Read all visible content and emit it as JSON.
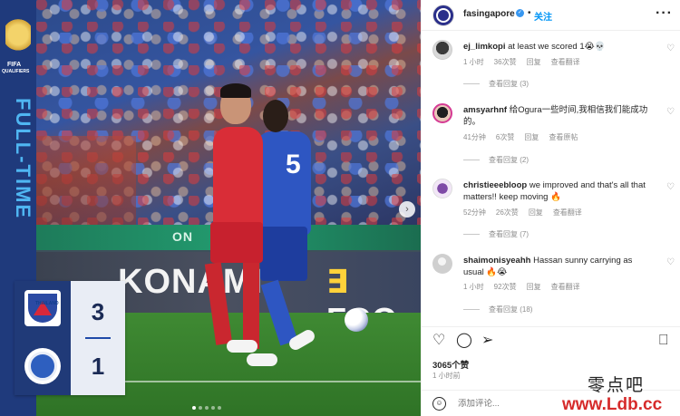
{
  "post": {
    "username": "fasingapore",
    "follow_label": "关注",
    "likes": "3065个赞",
    "time_ago": "1 小时前",
    "comment_placeholder": "添加评论..."
  },
  "media": {
    "sidebar_fifa": "FIFA",
    "sidebar_qualifiers": "QUALIFIERS",
    "sidebar_status": "FULL-TIME",
    "ad_board_text": "KONAMI",
    "ad_board_text2": "FOO",
    "green_board_text": "ON",
    "player_number": "5",
    "home_team_badge": "THAILAND",
    "home_score": "3",
    "away_score": "1",
    "carousel_dots": 5,
    "carousel_active": 1
  },
  "comments": [
    {
      "username": "ej_limkopi",
      "text": "at least we scored 1😭💀",
      "time": "1 小时",
      "likes": "36次赞",
      "reply": "回复",
      "translate": "查看翻译",
      "view_replies": "查看回复 (3)"
    },
    {
      "username": "amsyarhnf",
      "text": "给Ogura一些时间,我相信我们能成功的。",
      "time": "41分钟",
      "likes": "6次赞",
      "reply": "回复",
      "translate": "查看原帖",
      "view_replies": "查看回复 (2)"
    },
    {
      "username": "christieeebloop",
      "text": "we improved and that's all that matters!! keep moving 🔥",
      "time": "52分钟",
      "likes": "26次赞",
      "reply": "回复",
      "translate": "查看翻译",
      "view_replies": "查看回复 (7)"
    },
    {
      "username": "shaimonisyeahh",
      "text": "Hassan sunny carrying as usual 🔥😭",
      "time": "1 小时",
      "likes": "92次赞",
      "reply": "回复",
      "translate": "查看翻译",
      "view_replies": "查看回复 (18)"
    }
  ],
  "watermark": {
    "cn": "零点吧",
    "url": "www.Ldb.cc"
  },
  "icons": {
    "more": "more-horizontal-icon",
    "heart": "heart-icon",
    "comment": "comment-icon",
    "share": "send-icon",
    "save": "bookmark-icon",
    "emoji": "emoji-icon",
    "verified": "verified-badge-icon"
  },
  "colors": {
    "accent": "#0095f6",
    "sidebar": "#1f3a7c",
    "fulltime": "#4fb6f2"
  }
}
